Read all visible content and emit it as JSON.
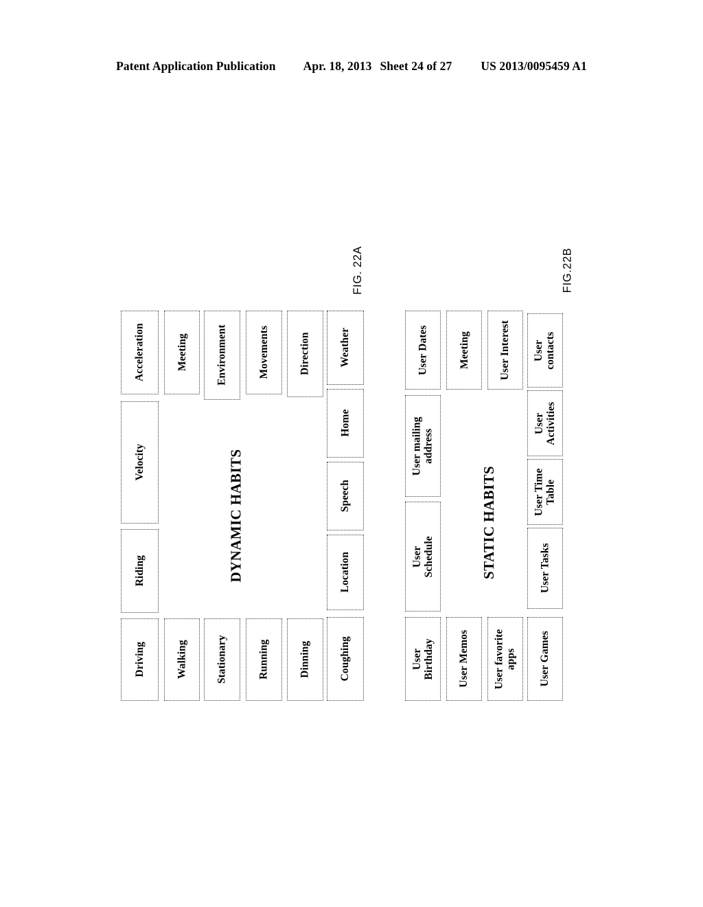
{
  "header": {
    "publication": "Patent Application Publication",
    "date": "Apr. 18, 2013",
    "sheet": "Sheet 24 of 27",
    "patent_number": "US 2013/0095459 A1"
  },
  "figures": [
    {
      "caption": "FIG. 22A",
      "title": "DYNAMIC HABITS",
      "nodes": [
        {
          "label": "Acceleration"
        },
        {
          "label": "Velocity"
        },
        {
          "label": "Riding"
        },
        {
          "label": "Driving"
        },
        {
          "label": "Meeting"
        },
        {
          "label": "Walking"
        },
        {
          "label": "Environment"
        },
        {
          "label": "Stationary"
        },
        {
          "label": "Movements"
        },
        {
          "label": "Running"
        },
        {
          "label": "Direction"
        },
        {
          "label": "Dinning"
        },
        {
          "label": "Weather"
        },
        {
          "label": "Home"
        },
        {
          "label": "Speech"
        },
        {
          "label": "Location"
        },
        {
          "label": "Coughing"
        }
      ]
    },
    {
      "caption": "FIG.22B",
      "title": "STATIC HABITS",
      "nodes": [
        {
          "label": "User Dates"
        },
        {
          "label": "User mailing\naddress"
        },
        {
          "label": "User\nSchedule"
        },
        {
          "label": "User\nBirthday"
        },
        {
          "label": "Meeting"
        },
        {
          "label": "User Memos"
        },
        {
          "label": "User Interest"
        },
        {
          "label": "User favorite\napps"
        },
        {
          "label": "User\ncontacts"
        },
        {
          "label": "User\nActivities"
        },
        {
          "label": "User Time\nTable"
        },
        {
          "label": "User Tasks"
        },
        {
          "label": "User Games"
        }
      ]
    }
  ],
  "colors": {
    "ink": "#000000",
    "border": "#3a3a3a",
    "page": "#ffffff"
  }
}
